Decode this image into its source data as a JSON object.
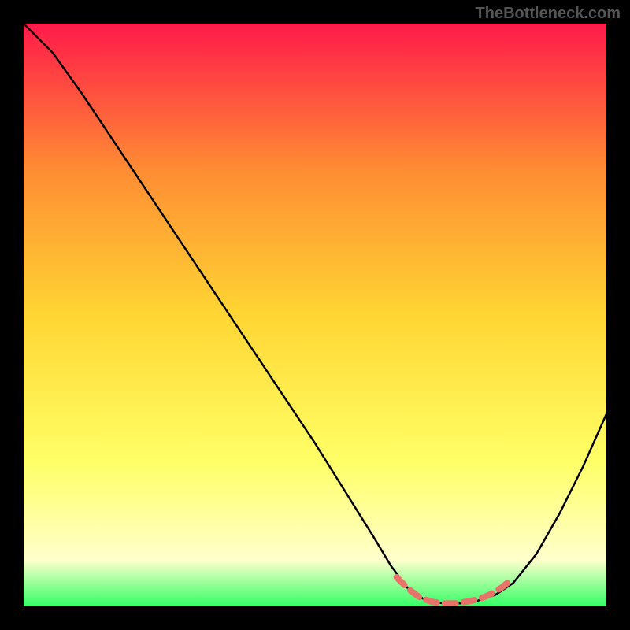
{
  "watermark": "TheBottleneck.com",
  "chart_data": {
    "type": "line",
    "title": "",
    "xlabel": "",
    "ylabel": "",
    "xlim": [
      0,
      100
    ],
    "ylim": [
      0,
      100
    ],
    "background_gradient": {
      "top": "#ff1a4a",
      "mid_upper": "#ff8c33",
      "mid": "#ffd633",
      "mid_lower": "#ffff66",
      "near_bottom": "#ffffcc",
      "bottom": "#33ff66"
    },
    "curve": {
      "description": "Black V-shaped bottleneck curve (high at left, minimum near x≈70, rising again to right)",
      "points_xy": [
        [
          0,
          100
        ],
        [
          5,
          95
        ],
        [
          10,
          88
        ],
        [
          20,
          73
        ],
        [
          30,
          58
        ],
        [
          40,
          43
        ],
        [
          50,
          28
        ],
        [
          55,
          20
        ],
        [
          60,
          12
        ],
        [
          63,
          7
        ],
        [
          66,
          3
        ],
        [
          69,
          1
        ],
        [
          72,
          0.5
        ],
        [
          75,
          0.5
        ],
        [
          78,
          1
        ],
        [
          81,
          2
        ],
        [
          84,
          4
        ],
        [
          88,
          9
        ],
        [
          92,
          16
        ],
        [
          96,
          24
        ],
        [
          100,
          33
        ]
      ]
    },
    "highlight_segment": {
      "color": "#e8736b",
      "description": "Dashed coral segment near curve minimum",
      "points_xy": [
        [
          64,
          5
        ],
        [
          66,
          3
        ],
        [
          68,
          1.5
        ],
        [
          70,
          0.8
        ],
        [
          72,
          0.5
        ],
        [
          74,
          0.5
        ],
        [
          76,
          0.8
        ],
        [
          78,
          1.2
        ],
        [
          80,
          2
        ],
        [
          82,
          3.2
        ],
        [
          83,
          4
        ]
      ]
    }
  }
}
